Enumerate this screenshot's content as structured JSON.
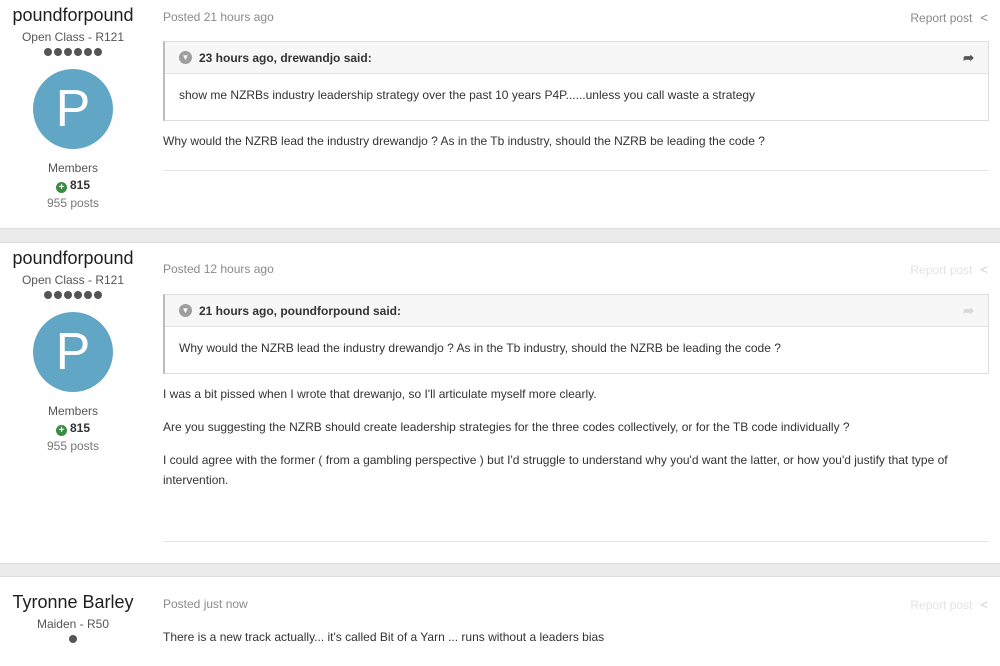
{
  "posts": [
    {
      "author": "poundforpound",
      "rank": "Open Class - R121",
      "avatar_letter": "P",
      "group": "Members",
      "reputation": "815",
      "post_count": "955 posts",
      "posted": "Posted 21 hours ago",
      "report": "Report post",
      "quote_header": "23 hours ago, drewandjo said:",
      "quote_text": "show me NZRBs industry leadership strategy over the past 10 years P4P......unless you call waste a strategy",
      "paragraphs": [
        "Why would the NZRB lead the industry drewandjo ? As in the Tb industry, should the NZRB be leading the code ?"
      ]
    },
    {
      "author": "poundforpound",
      "rank": "Open Class - R121",
      "avatar_letter": "P",
      "group": "Members",
      "reputation": "815",
      "post_count": "955 posts",
      "posted": "Posted 12 hours ago",
      "report": "Report post",
      "quote_header": "21 hours ago, poundforpound said:",
      "quote_text": "Why would the NZRB lead the industry drewandjo ? As in the Tb industry, should the NZRB be leading the code ?",
      "paragraphs": [
        "I was a bit pissed when I wrote that drewanjo, so I'll articulate myself more clearly.",
        "Are you suggesting the NZRB should create leadership strategies for the three codes collectively, or for the TB code individually ?",
        "I could agree with the former ( from a gambling perspective ) but I'd struggle to understand why you'd want the latter, or how you'd justify that type of intervention."
      ]
    },
    {
      "author": "Tyronne Barley",
      "rank": "Maiden - R50",
      "posted": "Posted just now",
      "report": "Report post",
      "paragraphs": [
        "There is a new track actually... it's called Bit of a Yarn ... runs without a leaders bias"
      ]
    }
  ],
  "icons": {
    "share": "share-icon",
    "quote_collapse": "chevron-down-icon",
    "quote_jump": "reply-arrow-icon",
    "reputation": "plus-circle-icon"
  },
  "colors": {
    "avatar": "#62a6c6",
    "reputation": "#3d8a43",
    "page_bg": "#ebebeb"
  }
}
